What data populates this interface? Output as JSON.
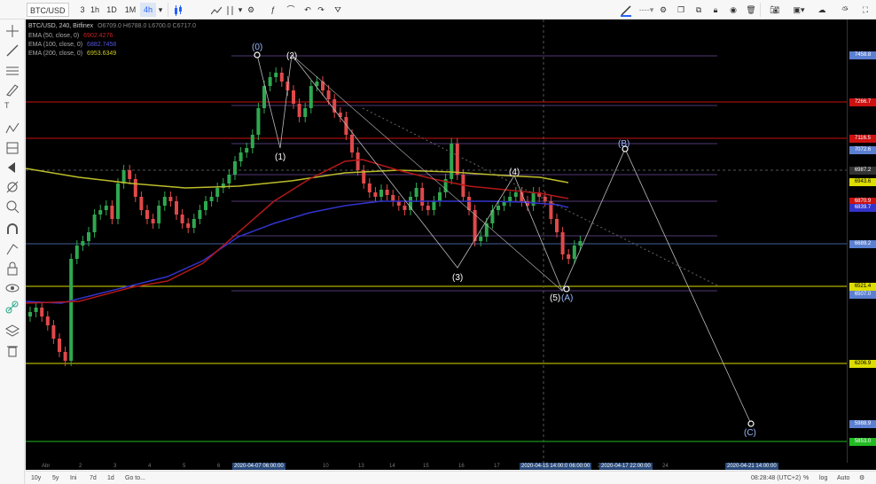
{
  "toolbar": {
    "symbol": "BTC/USD",
    "timeframes": [
      "3",
      "1h",
      "1D",
      "1M",
      "4h"
    ],
    "active_timeframe": "4h"
  },
  "legend": {
    "title": "BTC/USD, 240, Bitfinex",
    "ohlc": "O6709.0 H6788.0 L6700.0 C6717.0",
    "ema1_label": "EMA (50, close, 0)",
    "ema1_value": "6902.4276",
    "ema2_label": "EMA (100, close, 0)",
    "ema2_value": "6882.7458",
    "ema3_label": "EMA (200, close, 0)",
    "ema3_value": "6953.6349",
    "colors": {
      "ema1": "#cc2222",
      "ema2": "#3333cc",
      "ema3": "#cccc22"
    }
  },
  "price_labels": [
    {
      "text": "7458.8",
      "color": "#5b7fd1",
      "fg": "#fff"
    },
    {
      "text": "7266.7",
      "color": "#cc1111",
      "fg": "#fff"
    },
    {
      "text": "7116.5",
      "color": "#cc1111",
      "fg": "#fff"
    },
    {
      "text": "7072.6",
      "color": "#5b7fd1",
      "fg": "#fff"
    },
    {
      "text": "6987.2",
      "color": "#333",
      "fg": "#fff"
    },
    {
      "text": "6943.6",
      "color": "#dddd00",
      "fg": "#000"
    },
    {
      "text": "6870.9",
      "color": "#cc1111",
      "fg": "#fff"
    },
    {
      "text": "6839.7",
      "color": "#3333cc",
      "fg": "#fff"
    },
    {
      "text": "6689.2",
      "color": "#5b7fd1",
      "fg": "#fff"
    },
    {
      "text": "6521.4",
      "color": "#dddd00",
      "fg": "#000"
    },
    {
      "text": "6507.0",
      "color": "#5b7fd1",
      "fg": "#fff"
    },
    {
      "text": "6206.9",
      "color": "#dddd00",
      "fg": "#000"
    },
    {
      "text": "5988.9",
      "color": "#5b7fd1",
      "fg": "#fff"
    },
    {
      "text": "5853.0",
      "color": "#22bb22",
      "fg": "#fff"
    }
  ],
  "wave_labels": [
    "(0)",
    "(1)",
    "(2)",
    "(3)",
    "(4)",
    "(5)",
    "(A)",
    "(B)",
    "(C)"
  ],
  "time_labels": {
    "plain": [
      "Abr",
      "2",
      "3",
      "4",
      "5",
      "6",
      "9",
      "10",
      "13",
      "14",
      "15",
      "16",
      "17",
      "20",
      "21",
      "22",
      "23",
      "24"
    ],
    "highlight1": "2020-04-07 06:00:00",
    "highlight2": "2020-04-15 14:00:00",
    "highlight3": "06:00:00",
    "highlight4": "2020-04-17 22:00:00",
    "highlight5": "2020-04-21 14:00:00"
  },
  "bottombar": {
    "ranges": [
      "10y",
      "5y",
      "Ini",
      "7d",
      "1d"
    ],
    "goto": "Go to...",
    "clock": "08:28:48 (UTC+2)",
    "pct": "%",
    "log": "log",
    "auto": "Auto"
  },
  "icons": [
    "crosshair-icon",
    "trendline-icon",
    "horizontal-line-icon",
    "pitchfork-icon",
    "pen-icon",
    "text-icon",
    "pattern-icon",
    "prediction-icon",
    "fib-icon",
    "arrow-left-icon",
    "magnet-icon",
    "zoom-icon",
    "lock-icon",
    "eye-icon",
    "trash-icon",
    "link-icon",
    "layers-icon",
    "gear-icon",
    "camera-icon",
    "fullscreen-icon"
  ]
}
